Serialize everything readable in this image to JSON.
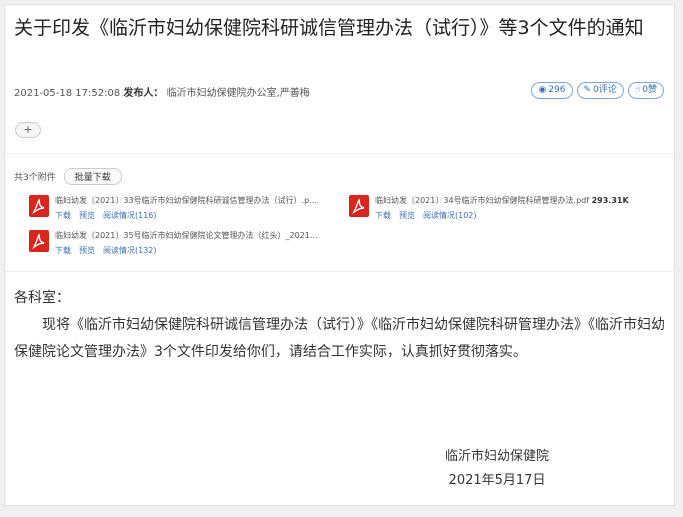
{
  "title": "关于印发《临沂市妇幼保健院科研诚信管理办法（试行）》等3个文件的通知",
  "meta": {
    "datetime": "2021-05-18 17:52:08",
    "publisher_label": "发布人：",
    "publisher": "临沂市妇幼保健院办公室,严善梅"
  },
  "stats": {
    "views": "296",
    "comments": "0评论",
    "likes": "0赞"
  },
  "plus": "+",
  "attachments": {
    "count_label": "共3个附件",
    "bulk_label": "批量下载",
    "files": [
      {
        "name": "临妇幼发〔2021〕33号临沂市妇幼保健院科研诚信管理办法（试行）.p...",
        "size": "",
        "download": "下载",
        "preview": "预览",
        "read": "阅读情况(116)"
      },
      {
        "name": "临妇幼发〔2021〕34号临沂市妇幼保健院科研管理办法.pdf",
        "size": "293.31K",
        "download": "下载",
        "preview": "预览",
        "read": "阅读情况(102)"
      },
      {
        "name": "临妇幼发〔2021〕35号临沂市妇幼保健院论文管理办法（红头）_2021...",
        "size": "",
        "download": "下载",
        "preview": "预览",
        "read": "阅读情况(132)"
      }
    ]
  },
  "body": {
    "greeting": "各科室：",
    "paragraph": "现将《临沂市妇幼保健院科研诚信管理办法（试行）》《临沂市妇幼保健院科研管理办法》《临沂市妇幼保健院论文管理办法》3个文件印发给你们，请结合工作实际，认真抓好贯彻落实。"
  },
  "signature": {
    "org": "临沂市妇幼保健院",
    "date": "2021年5月17日"
  },
  "icons": {
    "views": "eye-icon",
    "comments": "edit-icon",
    "likes": "thumbs-up-icon",
    "file": "pdf-icon"
  },
  "colors": {
    "pdf_red": "#d7261e",
    "link_blue": "#3b6fb0"
  }
}
